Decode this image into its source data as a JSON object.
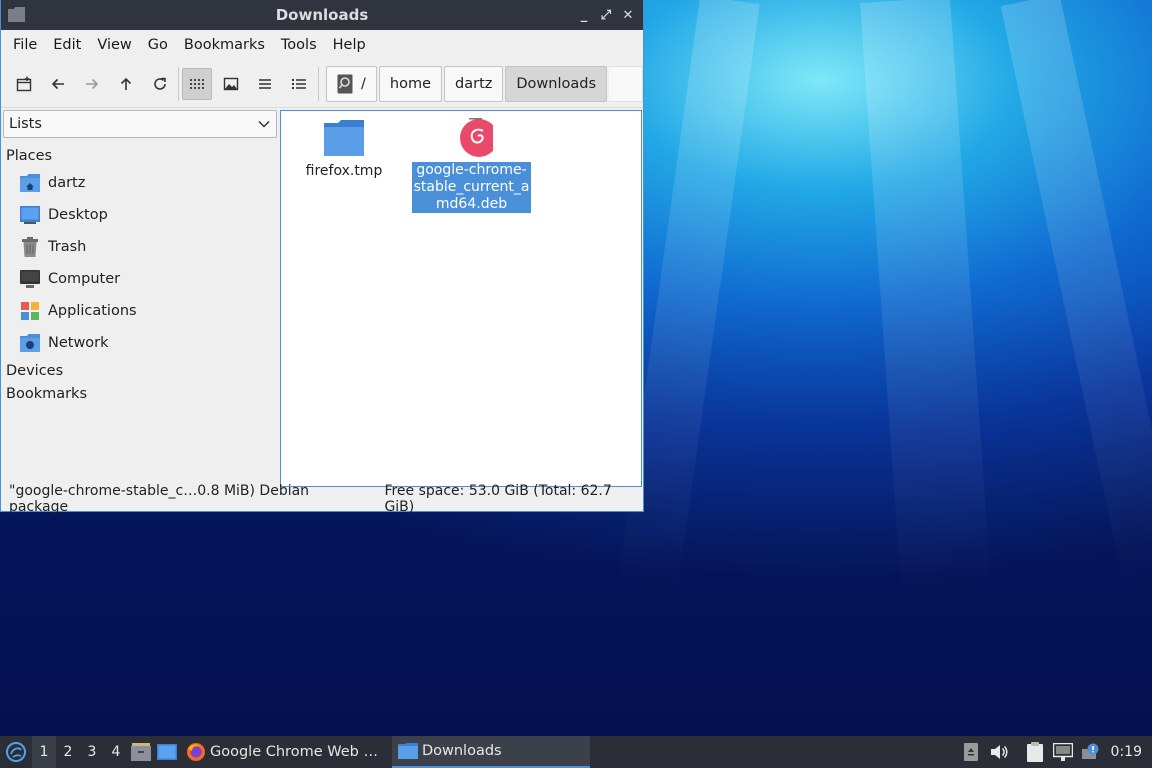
{
  "window": {
    "title": "Downloads",
    "buttons": {
      "minimize": "_",
      "maximize": "⤢",
      "close": "✕"
    }
  },
  "menu": [
    "File",
    "Edit",
    "View",
    "Go",
    "Bookmarks",
    "Tools",
    "Help"
  ],
  "toolbar": {
    "path_root": "/",
    "path": [
      "home",
      "dartz",
      "Downloads"
    ]
  },
  "sidebar": {
    "combo_value": "Lists",
    "sections": {
      "places": "Places",
      "devices": "Devices",
      "bookmarks": "Bookmarks"
    },
    "places": [
      {
        "label": "dartz",
        "icon": "home-folder-icon"
      },
      {
        "label": "Desktop",
        "icon": "desktop-icon"
      },
      {
        "label": "Trash",
        "icon": "trash-icon"
      },
      {
        "label": "Computer",
        "icon": "computer-icon"
      },
      {
        "label": "Applications",
        "icon": "applications-icon"
      },
      {
        "label": "Network",
        "icon": "network-icon"
      }
    ]
  },
  "files": [
    {
      "name": "firefox.tmp",
      "icon": "folder-icon"
    },
    {
      "name_lines": [
        "google-chrome-",
        "stable_current_a",
        "md64.deb"
      ],
      "icon": "debian-package-icon",
      "selected": true
    }
  ],
  "status": {
    "selection": "\"google-chrome-stable_c…0.8 MiB) Debian package",
    "free": "Free space: 53.0 GiB (Total: 62.7 GiB)"
  },
  "taskbar": {
    "workspaces": [
      "1",
      "2",
      "3",
      "4"
    ],
    "tasks": [
      {
        "label": "Google Chrome Web …",
        "icon": "firefox-icon"
      },
      {
        "label": "Downloads",
        "icon": "folder-icon",
        "active": true
      }
    ],
    "clock": "0:19"
  },
  "colors": {
    "accent": "#4a90d9",
    "titlebar": "#2f343f",
    "taskbar": "#2b2e37"
  }
}
